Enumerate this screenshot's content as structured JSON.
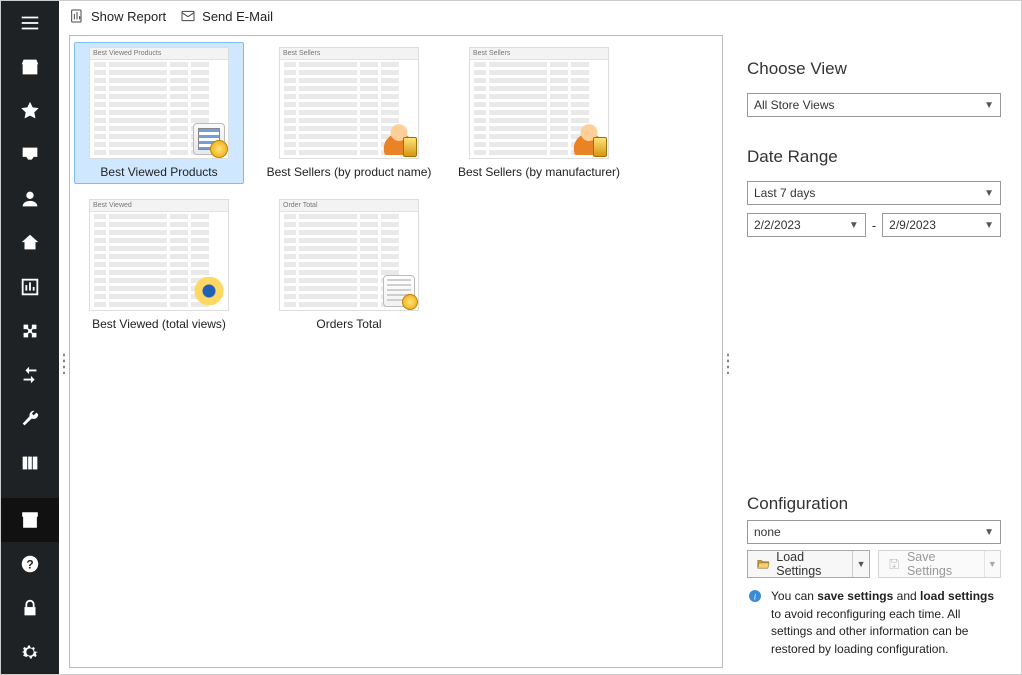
{
  "toolbar": {
    "show_report": "Show Report",
    "send_email": "Send E-Mail"
  },
  "tiles": [
    {
      "label": "Best Viewed Products",
      "thumb_title": "Best Viewed Products",
      "badge": "table",
      "selected": true
    },
    {
      "label": "Best Sellers (by product name)",
      "thumb_title": "Best Sellers",
      "badge": "person",
      "selected": false
    },
    {
      "label": "Best Sellers (by manufacturer)",
      "thumb_title": "Best Sellers",
      "badge": "person",
      "selected": false
    },
    {
      "label": "Best Viewed (total views)",
      "thumb_title": "Best Viewed",
      "badge": "eye",
      "selected": false
    },
    {
      "label": "Orders Total",
      "thumb_title": "Order Total",
      "badge": "doc",
      "selected": false
    }
  ],
  "right": {
    "choose_view_title": "Choose View",
    "view_value": "All Store Views",
    "date_range_title": "Date Range",
    "range_preset": "Last 7 days",
    "date_from": "2/2/2023",
    "date_to": "2/9/2023",
    "config_title": "Configuration",
    "config_value": "none",
    "load_settings": "Load Settings",
    "save_settings": "Save Settings",
    "info_pre": "You can ",
    "info_b1": "save settings",
    "info_mid": " and ",
    "info_b2": "load settings",
    "info_post": " to avoid reconfiguring each time. All settings and other information can be restored by loading configuration."
  },
  "sidebar_icons": [
    "menu-icon",
    "store-icon",
    "star-icon",
    "inbox-icon",
    "user-icon",
    "home-icon",
    "chart-icon",
    "puzzle-icon",
    "transfer-icon",
    "wrench-icon",
    "columns-icon",
    "archive-icon",
    "help-icon",
    "lock-icon",
    "gear-icon"
  ]
}
